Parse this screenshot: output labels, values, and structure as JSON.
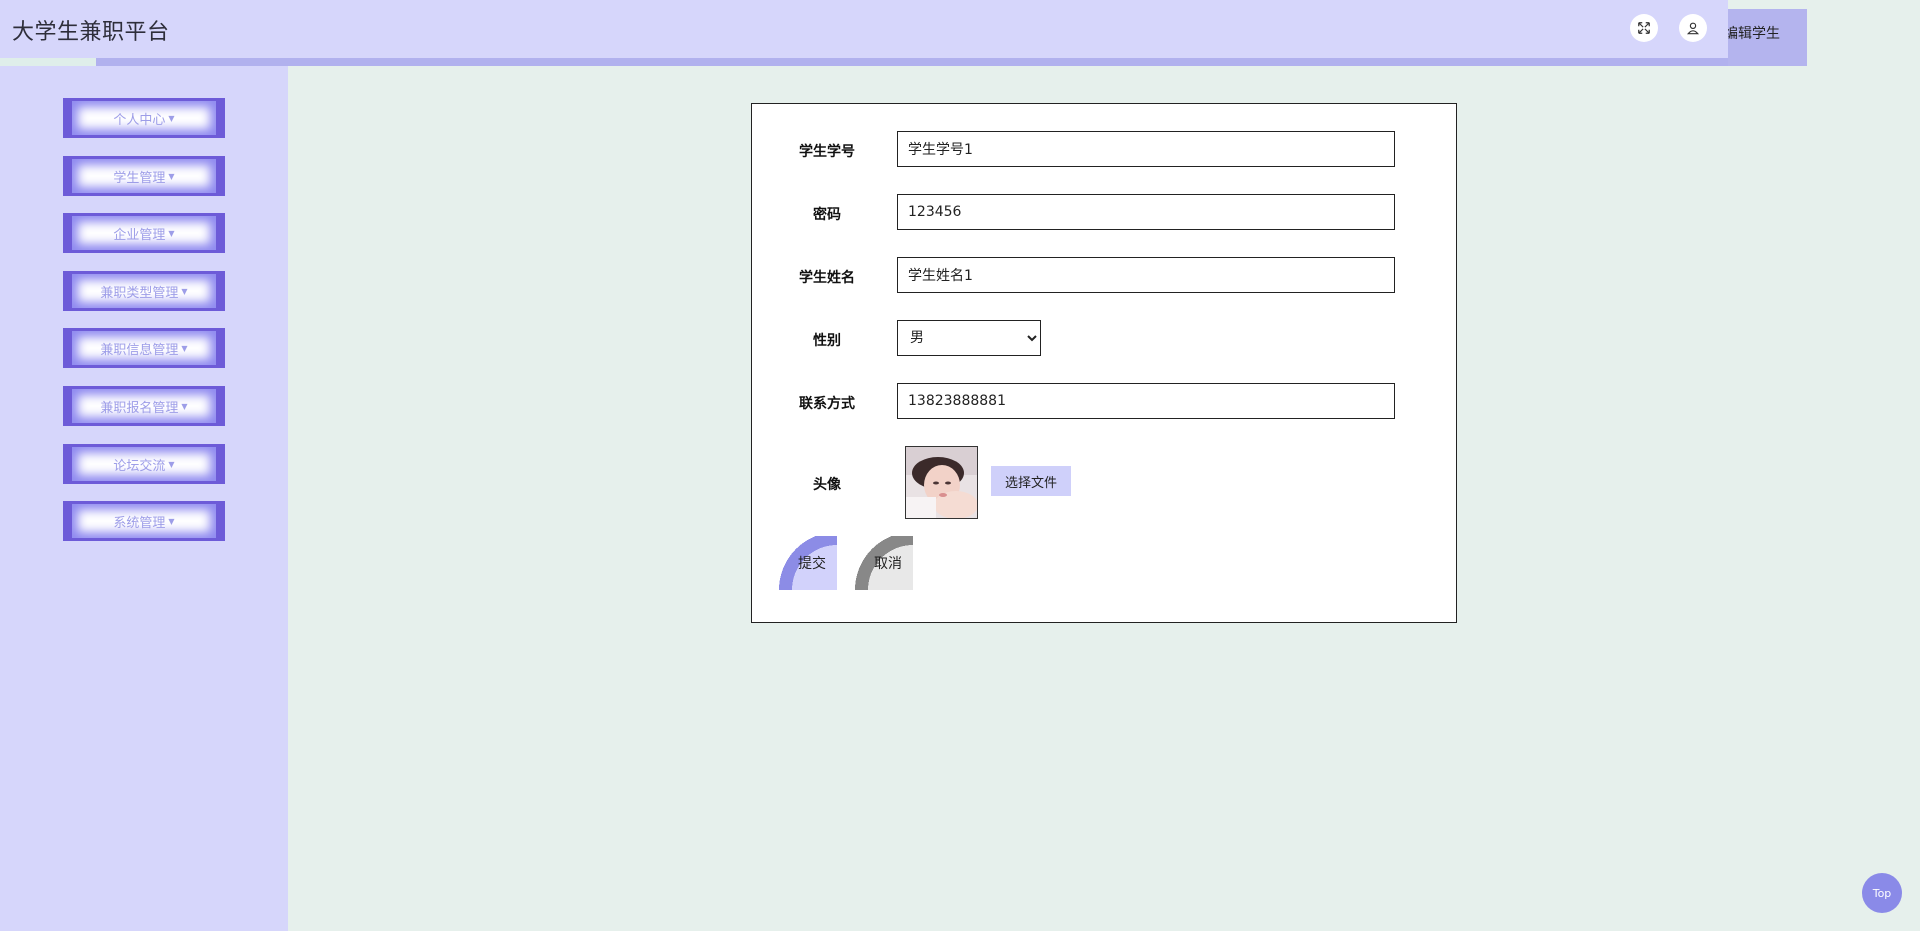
{
  "app": {
    "title": "大学生兼职平台",
    "role_label": "编辑学生"
  },
  "header": {
    "fullscreen_icon": "expand-icon",
    "user_icon": "user-icon"
  },
  "sidebar": {
    "items": [
      {
        "label": "个人中心"
      },
      {
        "label": "学生管理"
      },
      {
        "label": "企业管理"
      },
      {
        "label": "兼职类型管理"
      },
      {
        "label": "兼职信息管理"
      },
      {
        "label": "兼职报名管理"
      },
      {
        "label": "论坛交流"
      },
      {
        "label": "系统管理"
      }
    ]
  },
  "form": {
    "student_id": {
      "label": "学生学号",
      "value": "学生学号1"
    },
    "password": {
      "label": "密码",
      "value": "123456"
    },
    "student_name": {
      "label": "学生姓名",
      "value": "学生姓名1"
    },
    "gender": {
      "label": "性别",
      "value": "男"
    },
    "contact": {
      "label": "联系方式",
      "value": "13823888881"
    },
    "avatar": {
      "label": "头像",
      "choose_file_label": "选择文件"
    },
    "submit_label": "提交",
    "cancel_label": "取消"
  },
  "top_button": {
    "label": "Top"
  },
  "colors": {
    "header_bg": "#d6d6fb",
    "menu_border": "#6d5bd8",
    "page_bg": "#e6f0ec",
    "accent": "#8a8ae8"
  }
}
